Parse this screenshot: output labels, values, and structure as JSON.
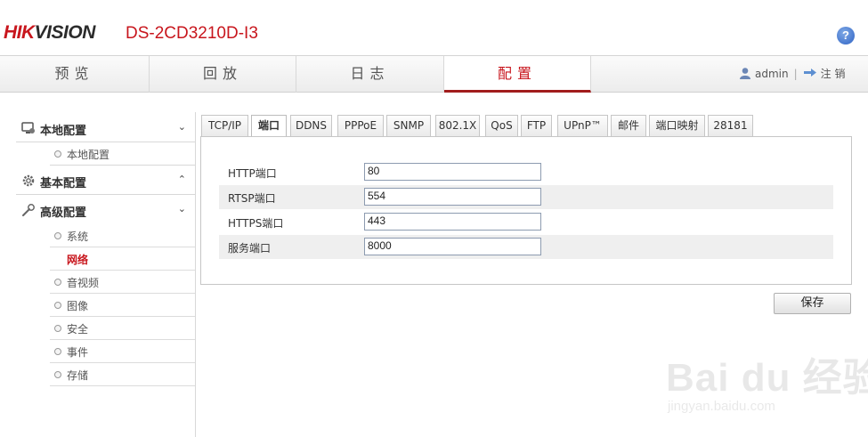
{
  "header": {
    "logo_red": "HIK",
    "logo_dark": "VISION",
    "model": "DS-2CD3210D-I3",
    "help_label": "?"
  },
  "nav": {
    "tabs": [
      {
        "label": "预览"
      },
      {
        "label": "回放"
      },
      {
        "label": "日志"
      },
      {
        "label": "配置"
      }
    ],
    "active_tab": "配置",
    "user": "admin",
    "separator": "|",
    "logout": "注 销"
  },
  "sidebar": {
    "groups": [
      {
        "label": "本地配置",
        "chevron": "⌄",
        "icon": "monitor-icon",
        "items": [
          {
            "label": "本地配置"
          }
        ]
      },
      {
        "label": "基本配置",
        "chevron": "⌃",
        "icon": "gear-icon",
        "items": []
      },
      {
        "label": "高级配置",
        "chevron": "⌄",
        "icon": "wrench-icon",
        "items": [
          {
            "label": "系统"
          },
          {
            "label": "网络"
          },
          {
            "label": "音视频"
          },
          {
            "label": "图像"
          },
          {
            "label": "安全"
          },
          {
            "label": "事件"
          },
          {
            "label": "存储"
          }
        ]
      }
    ],
    "active_item": "网络"
  },
  "tabs": [
    {
      "label": "TCP/IP"
    },
    {
      "label": "端口"
    },
    {
      "label": "DDNS"
    },
    {
      "label": "PPPoE"
    },
    {
      "label": "SNMP"
    },
    {
      "label": "802.1X"
    },
    {
      "label": "QoS"
    },
    {
      "label": "FTP"
    },
    {
      "label": "UPnP™"
    },
    {
      "label": "邮件"
    },
    {
      "label": "端口映射"
    },
    {
      "label": "28181"
    }
  ],
  "active_tab": "端口",
  "ports": [
    {
      "label": "HTTP端口",
      "value": "80"
    },
    {
      "label": "RTSP端口",
      "value": "554"
    },
    {
      "label": "HTTPS端口",
      "value": "443"
    },
    {
      "label": "服务端口",
      "value": "8000"
    }
  ],
  "save_label": "保存",
  "watermark": {
    "main": "Bai du 经验",
    "sub": "jingyan.baidu.com"
  },
  "colors": {
    "brand_red": "#c8161d",
    "active_underline": "#a11c1c"
  }
}
